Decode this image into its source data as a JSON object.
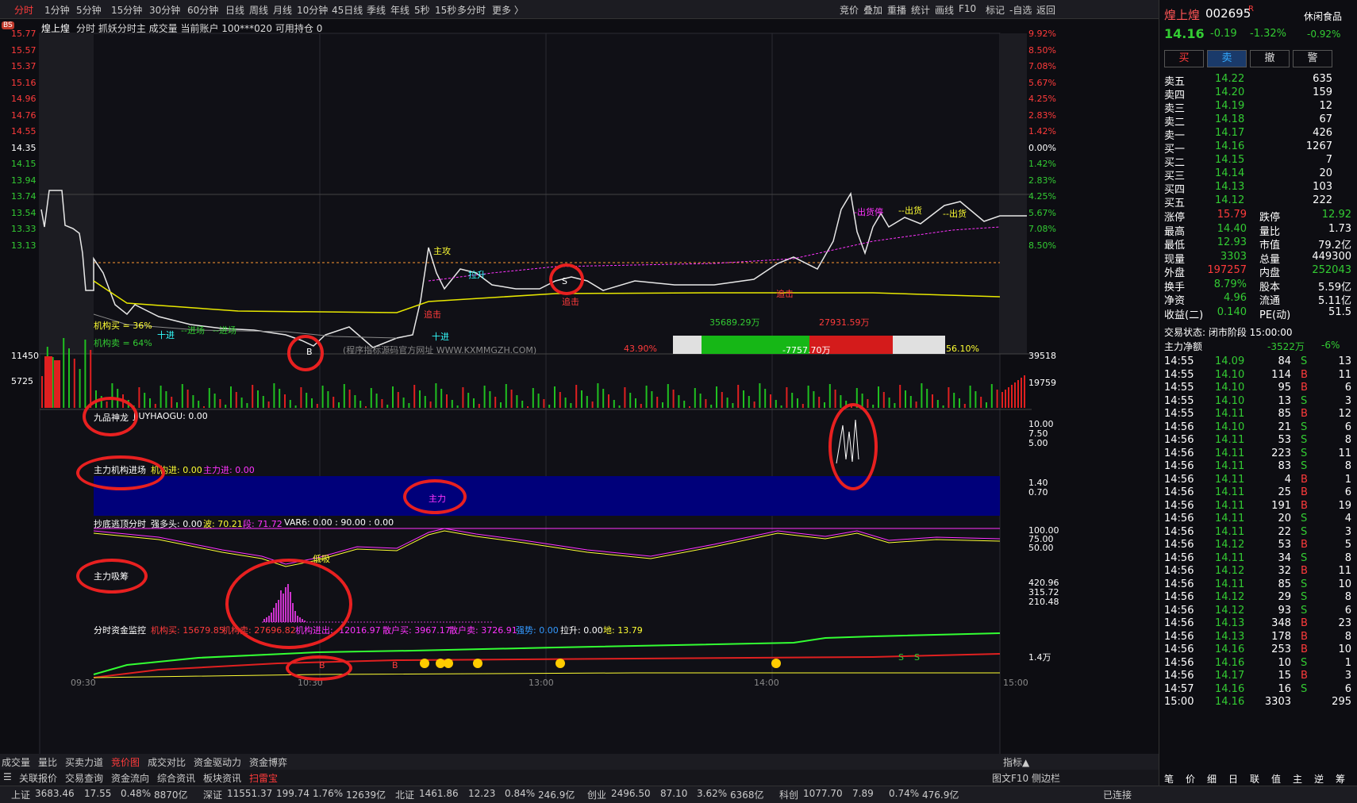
{
  "toolbar": {
    "periods": [
      "分时",
      "1分钟",
      "5分钟",
      "15分钟",
      "30分钟",
      "60分钟",
      "日线",
      "周线",
      "月线",
      "10分钟",
      "45日线",
      "季线",
      "年线",
      "5秒",
      "15秒",
      "多分时",
      "更多 〉"
    ],
    "tools": [
      "竞价",
      "叠加",
      "重播",
      "统计",
      "画线",
      "F10",
      "标记",
      "-自选",
      "返回"
    ]
  },
  "chart_header": {
    "stock": "煌上煌",
    "info": "分时 抓妖分时主 成交量 当前账户 100***020 可用持仓 0",
    "bs": "BS"
  },
  "price_axis": [
    "15.77",
    "15.57",
    "15.37",
    "15.16",
    "14.96",
    "14.76",
    "14.55",
    "14.35",
    "14.15",
    "13.94",
    "13.74",
    "13.54",
    "13.33",
    "13.13"
  ],
  "pct_axis": [
    "9.92%",
    "8.50%",
    "7.08%",
    "5.67%",
    "4.25%",
    "2.83%",
    "1.42%",
    "0.00%",
    "1.42%",
    "2.83%",
    "4.25%",
    "5.67%",
    "7.08%",
    "8.50%"
  ],
  "chart_labels": {
    "inst_buy": "机构买 = 36%",
    "inst_sell": "机构卖 = 64%",
    "zhugong": "主攻",
    "lasheng": "拉升",
    "s": "S",
    "zhuiji1": "追击",
    "zhuiji2": "追击",
    "zhuiji3": "追击",
    "chuhuo1": "--出货",
    "chuhuo2": "--出货",
    "chuhuo3": "--出货",
    "chuhuo_stop": "-出货停",
    "jin1": "十进",
    "jin2": "十进",
    "jin3": "--进场",
    "jin4": "--进场",
    "watermark": "(程序指标源码官方网址 WWW.KXMMGZH.COM)",
    "b": "B",
    "buy_amt": "35689.29万",
    "sell_amt": "27931.59万",
    "bar_left": "43.90%",
    "bar_mid": "-7757.70万",
    "bar_right": "56.10%"
  },
  "volume_axis": {
    "left": [
      "11450",
      "5725"
    ],
    "right": [
      "39518",
      "19759"
    ]
  },
  "ind1": {
    "title": "九品神龙",
    "text": "JIUYHAOGU: 0.00",
    "axis": [
      "10.00",
      "7.50",
      "5.00"
    ]
  },
  "ind2": {
    "title": "主力机构进场",
    "a": "机构进: 0.00",
    "b": "主力进: 0.00",
    "label": "主力",
    "axis": [
      "1.40",
      "0.70"
    ]
  },
  "ind3": {
    "title": "抄底逃顶分时",
    "a": "强多头: 0.00",
    "b": "波: 70.21",
    "c": "段: 71.72",
    "d": "VAR6: 0.00 : 90.00 : 0.00",
    "label": "低吸",
    "axis": [
      "100.00",
      "75.00",
      "50.00"
    ]
  },
  "ind4": {
    "title": "主力吸筹",
    "axis": [
      "420.96",
      "315.72",
      "210.48"
    ]
  },
  "ind5": {
    "title": "分时资金监控",
    "a": "机构买: 15679.85",
    "b": "机构卖: 27696.82",
    "c": "机构进出: -12016.97",
    "d": "散户买: 3967.17",
    "e": "散户卖: 3726.91",
    "f": "强势: 0.00",
    "g": "拉升: 0.00",
    "h": "地: 13.79",
    "axis": "1.4万",
    "b1": "B",
    "b2": "B",
    "s1": "S",
    "s2": "S"
  },
  "time_axis": [
    "09:30",
    "10:30",
    "13:00",
    "14:00",
    "15:00"
  ],
  "bottom_tabs1": [
    "成交量",
    "量比",
    "买卖力道",
    "竞价图",
    "成交对比",
    "资金驱动力",
    "资金博弈"
  ],
  "bottom_tabs1_right": "指标▲",
  "bottom_tabs2": [
    "关联报价",
    "交易查询",
    "资金流向",
    "综合资讯",
    "板块资讯",
    "扫雷宝"
  ],
  "bottom_tabs2_right": [
    "图文F10",
    "侧边栏"
  ],
  "quote": {
    "name": "煌上煌",
    "code": "002695",
    "badge": "R",
    "price": "14.16",
    "chg": "-0.19",
    "pct": "-1.32%",
    "sector": "休闲食品",
    "sector_pct": "-0.92%",
    "buttons": [
      "买",
      "卖",
      "撤",
      "警"
    ],
    "asks": [
      [
        "卖五",
        "14.22",
        "635"
      ],
      [
        "卖四",
        "14.20",
        "159"
      ],
      [
        "卖三",
        "14.19",
        "12"
      ],
      [
        "卖二",
        "14.18",
        "67"
      ],
      [
        "卖一",
        "14.17",
        "426"
      ]
    ],
    "bids": [
      [
        "买一",
        "14.16",
        "1267"
      ],
      [
        "买二",
        "14.15",
        "7"
      ],
      [
        "买三",
        "14.14",
        "20"
      ],
      [
        "买四",
        "14.13",
        "103"
      ],
      [
        "买五",
        "14.12",
        "222"
      ]
    ],
    "stats": [
      [
        "涨停",
        "15.79",
        "跌停",
        "12.92"
      ],
      [
        "最高",
        "14.40",
        "量比",
        "1.73"
      ],
      [
        "最低",
        "12.93",
        "市值",
        "79.2亿"
      ],
      [
        "现量",
        "3303",
        "总量",
        "449300"
      ],
      [
        "外盘",
        "197257",
        "内盘",
        "252043"
      ],
      [
        "换手",
        "8.79%",
        "股本",
        "5.59亿"
      ],
      [
        "净资",
        "4.96",
        "流通",
        "5.11亿"
      ],
      [
        "收益(二)",
        "0.140",
        "PE(动)",
        "51.5"
      ]
    ],
    "status_label": "交易状态: 闭市阶段 15:00:00",
    "netflow_label": "主力净额",
    "netflow_val": "-3522万",
    "netflow_pct": "-6%",
    "ticks": [
      [
        "14:55",
        "14.09",
        "84",
        "S",
        "13"
      ],
      [
        "14:55",
        "14.10",
        "114",
        "B",
        "11"
      ],
      [
        "14:55",
        "14.10",
        "95",
        "B",
        "6"
      ],
      [
        "14:55",
        "14.10",
        "13",
        "S",
        "3"
      ],
      [
        "14:55",
        "14.11",
        "85",
        "B",
        "12"
      ],
      [
        "14:56",
        "14.10",
        "21",
        "S",
        "6"
      ],
      [
        "14:56",
        "14.11",
        "53",
        "S",
        "8"
      ],
      [
        "14:56",
        "14.11",
        "223",
        "S",
        "11"
      ],
      [
        "14:56",
        "14.11",
        "83",
        "S",
        "8"
      ],
      [
        "14:56",
        "14.11",
        "4",
        "B",
        "1"
      ],
      [
        "14:56",
        "14.11",
        "25",
        "B",
        "6"
      ],
      [
        "14:56",
        "14.11",
        "191",
        "B",
        "19"
      ],
      [
        "14:56",
        "14.11",
        "20",
        "S",
        "4"
      ],
      [
        "14:56",
        "14.11",
        "22",
        "S",
        "3"
      ],
      [
        "14:56",
        "14.12",
        "53",
        "B",
        "5"
      ],
      [
        "14:56",
        "14.11",
        "34",
        "S",
        "8"
      ],
      [
        "14:56",
        "14.12",
        "32",
        "B",
        "11"
      ],
      [
        "14:56",
        "14.11",
        "85",
        "S",
        "10"
      ],
      [
        "14:56",
        "14.12",
        "29",
        "S",
        "8"
      ],
      [
        "14:56",
        "14.12",
        "93",
        "S",
        "6"
      ],
      [
        "14:56",
        "14.13",
        "348",
        "B",
        "23"
      ],
      [
        "14:56",
        "14.13",
        "178",
        "B",
        "8"
      ],
      [
        "14:56",
        "14.16",
        "253",
        "B",
        "10"
      ],
      [
        "14:56",
        "14.16",
        "10",
        "S",
        "1"
      ],
      [
        "14:56",
        "14.17",
        "15",
        "B",
        "3"
      ],
      [
        "14:57",
        "14.16",
        "16",
        "S",
        "6"
      ],
      [
        "15:00",
        "14.16",
        "3303",
        "",
        "295"
      ]
    ],
    "side_tabs": [
      "笔",
      "价",
      "细",
      "日",
      "联",
      "值",
      "主",
      "逆",
      "筹"
    ]
  },
  "status_bar": {
    "items": [
      [
        "上证",
        "3683.46",
        "17.55",
        "0.48%",
        "8870亿"
      ],
      [
        "深证",
        "11551.37",
        "199.74",
        "1.76%",
        "12639亿"
      ],
      [
        "北证",
        "1461.86",
        "12.23",
        "0.84%",
        "246.9亿"
      ],
      [
        "创业",
        "2496.50",
        "87.10",
        "3.62%",
        "6368亿"
      ],
      [
        "科创",
        "1077.70",
        "7.89",
        "0.74%",
        "476.9亿"
      ]
    ],
    "conn": "已连接"
  }
}
